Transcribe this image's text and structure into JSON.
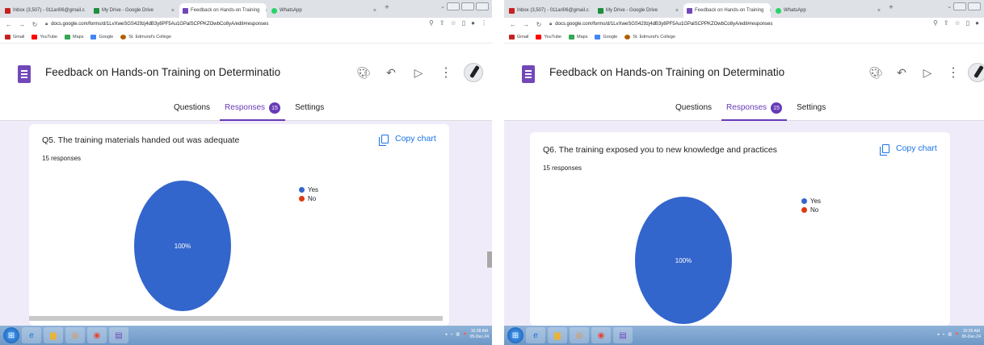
{
  "screens": [
    {
      "id": "left",
      "browser": {
        "tabs": [
          {
            "label": "Inbox (3,507) - 011ari06@gmail.c",
            "close": "×",
            "active": false,
            "color": "#c5221f"
          },
          {
            "label": "My Drive - Google Drive",
            "close": "×",
            "active": false,
            "color": "#1e8e3e"
          },
          {
            "label": "Feedback on Hands-on Training",
            "close": "×",
            "active": true,
            "color": "#7248b9"
          },
          {
            "label": "WhatsApp",
            "close": "×",
            "active": false,
            "color": "#25d366"
          }
        ],
        "new_tab": "+",
        "url": "docs.google.com/forms/d/1LvXweSGS429zj4dB3y8PF5Au1GPalSCPPKZOwbCo8yA/edit#responses",
        "bookmarks": [
          {
            "label": "Gmail",
            "color": "#c5221f"
          },
          {
            "label": "YouTube",
            "color": "#ff0000"
          },
          {
            "label": "Maps",
            "color": "#34a853"
          },
          {
            "label": "Google",
            "color": "#4285f4"
          },
          {
            "label": "St. Edmund's College",
            "color": "#b06000"
          }
        ]
      },
      "form": {
        "title": "Feedback on Hands-on Training on Determinatio",
        "tabs": {
          "questions": "Questions",
          "responses": "Responses",
          "responses_count": "15",
          "settings": "Settings"
        }
      },
      "question": {
        "title": "Q5.  The training materials handed out was adequate",
        "responses_text": "15 responses",
        "copy_chart": "Copy chart"
      },
      "clock": {
        "time": "10:28 AM",
        "date": "05-Dec-24"
      }
    },
    {
      "id": "right",
      "browser": {
        "tabs": [
          {
            "label": "Inbox (3,507) - 011ari06@gmail.c",
            "close": "×",
            "active": false,
            "color": "#c5221f"
          },
          {
            "label": "My Drive - Google Drive",
            "close": "×",
            "active": false,
            "color": "#1e8e3e"
          },
          {
            "label": "Feedback on Hands-on Training",
            "close": "×",
            "active": true,
            "color": "#7248b9"
          },
          {
            "label": "WhatsApp",
            "close": "×",
            "active": false,
            "color": "#25d366"
          }
        ],
        "new_tab": "+",
        "url": "docs.google.com/forms/d/1LvXweSGS429zj4dB3y8PF5Au1GPalSCPPKZOwbCo8yA/edit#responses",
        "bookmarks": [
          {
            "label": "Gmail",
            "color": "#c5221f"
          },
          {
            "label": "YouTube",
            "color": "#ff0000"
          },
          {
            "label": "Maps",
            "color": "#34a853"
          },
          {
            "label": "Google",
            "color": "#4285f4"
          },
          {
            "label": "St. Edmund's College",
            "color": "#b06000"
          }
        ]
      },
      "form": {
        "title": "Feedback on Hands-on Training on Determinatio",
        "tabs": {
          "questions": "Questions",
          "responses": "Responses",
          "responses_count": "15",
          "settings": "Settings"
        }
      },
      "question": {
        "title": "Q6.  The training exposed you to new knowledge and practices",
        "responses_text": "15 responses",
        "copy_chart": "Copy chart"
      },
      "clock": {
        "time": "10:29 AM",
        "date": "05-Dec-24"
      }
    }
  ],
  "chart_data": [
    {
      "type": "pie",
      "categories": [
        "Yes",
        "No"
      ],
      "values": [
        100,
        0
      ],
      "slice_label": "100%",
      "colors": [
        "#3366cc",
        "#dc3912"
      ],
      "legend": "right"
    },
    {
      "type": "pie",
      "categories": [
        "Yes",
        "No"
      ],
      "values": [
        100,
        0
      ],
      "slice_label": "100%",
      "colors": [
        "#3366cc",
        "#dc3912"
      ],
      "legend": "right"
    }
  ],
  "colors": {
    "forms_purple": "#673ab7",
    "content_bg": "#f0ebf8",
    "link_blue": "#1a73e8"
  }
}
